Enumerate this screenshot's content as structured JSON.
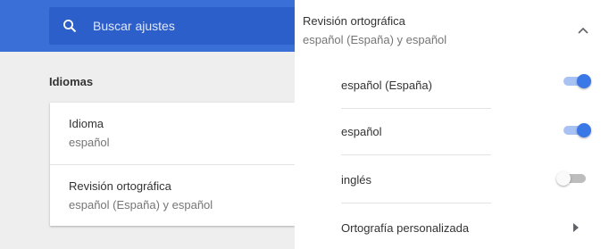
{
  "search": {
    "placeholder": "Buscar ajustes",
    "icon": "search-icon"
  },
  "languages_section": {
    "title": "Idiomas",
    "rows": [
      {
        "title": "Idioma",
        "subtitle": "español"
      },
      {
        "title": "Revisión ortográfica",
        "subtitle": "español (España) y español"
      }
    ]
  },
  "spellcheck_panel": {
    "title": "Revisión ortográfica",
    "subtitle": "español (España) y español",
    "collapse_icon": "chevron-up-icon",
    "items": [
      {
        "label": "español (España)",
        "enabled": true
      },
      {
        "label": "español",
        "enabled": true
      },
      {
        "label": "inglés",
        "enabled": false
      }
    ],
    "custom": {
      "label": "Ortografía personalizada",
      "icon": "chevron-right-icon"
    }
  },
  "colors": {
    "accent": "#3b78e7",
    "topbar": "#3a6fd8"
  }
}
